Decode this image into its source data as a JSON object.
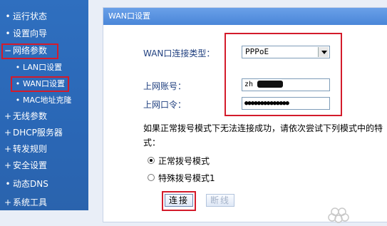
{
  "sidebar": {
    "items": [
      {
        "label": "运行状态",
        "marker": "•"
      },
      {
        "label": "设置向导",
        "marker": "•"
      },
      {
        "label": "网络参数",
        "marker": "−"
      },
      {
        "label": "LAN口设置",
        "marker": "•"
      },
      {
        "label": "WAN口设置",
        "marker": "•"
      },
      {
        "label": "MAC地址克隆",
        "marker": "•"
      },
      {
        "label": "无线参数",
        "marker": "+"
      },
      {
        "label": "DHCP服务器",
        "marker": "+"
      },
      {
        "label": "转发规则",
        "marker": "+"
      },
      {
        "label": "安全设置",
        "marker": "+"
      },
      {
        "label": "动态DNS",
        "marker": "•"
      },
      {
        "label": "系统工具",
        "marker": "+"
      }
    ]
  },
  "panel": {
    "title": "WAN口设置",
    "conn_type_label": "WAN口连接类型：",
    "conn_type_value": "PPPoE",
    "account_label": "上网账号：",
    "account_value": "zh                @xmlan",
    "password_label": "上网口令：",
    "password_value": "●●●●●●●●●●●●●●",
    "hint_line1": "如果正常拨号模式下无法连接成功，请依次尝试下列模式中的特",
    "hint_line2": "式：",
    "radio_normal": "正常拨号模式",
    "radio_special": "特殊拨号模式1",
    "connect_button": "连接",
    "disconnect_button": "断线"
  },
  "colors": {
    "sidebar_bg": "#2a67b6",
    "highlight_red": "#d31b2b",
    "panel_header": "#4a86d8"
  }
}
